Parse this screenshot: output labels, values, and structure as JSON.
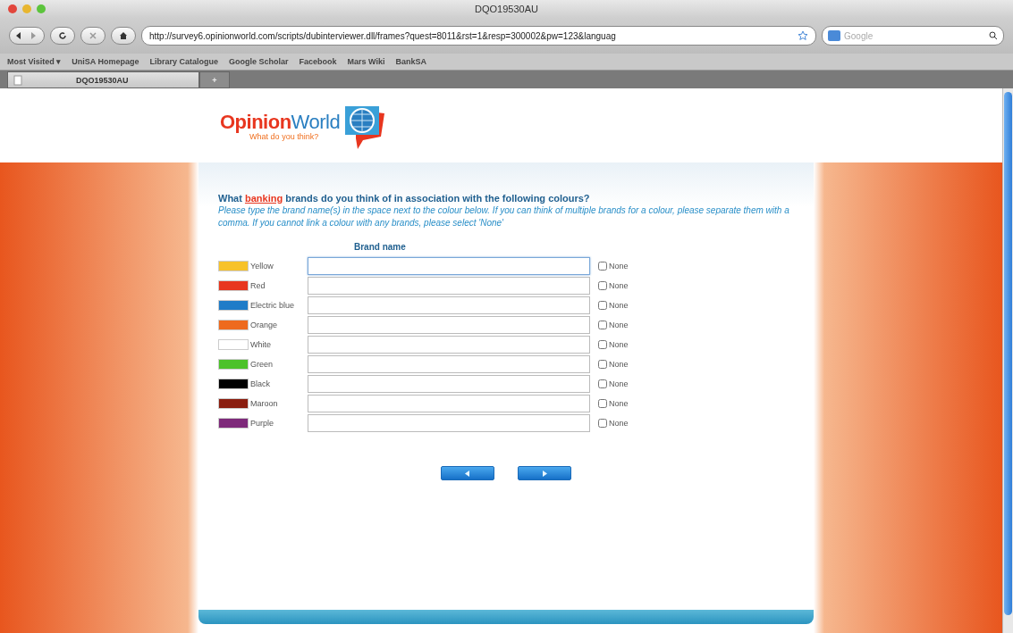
{
  "window": {
    "title": "DQO19530AU"
  },
  "toolbar": {
    "url": "http://survey6.opinionworld.com/scripts/dubinterviewer.dll/frames?quest=8011&rst=1&resp=300002&pw=123&languag",
    "search_placeholder": "Google"
  },
  "bookmarks": [
    "Most Visited ▾",
    "UniSA Homepage",
    "Library Catalogue",
    "Google Scholar",
    "Facebook",
    "Mars Wiki",
    "BankSA"
  ],
  "tabs": [
    {
      "label": "DQO19530AU",
      "selected": true
    },
    {
      "label": "+",
      "selected": false
    }
  ],
  "logo": {
    "name_part1": "Opinion",
    "name_part2": "World",
    "tagline": "What do you think?"
  },
  "question": {
    "title": "What **banking** brands do you think of in association with the following colours?",
    "instructions": "Please type the brand name(s) in the space next to the colour below. If you can think of multiple brands for a colour, please separate them with a comma. If you cannot link a colour with any brands, please select 'None'"
  },
  "column_header": "Brand name",
  "rows": [
    {
      "label": "Yellow",
      "color": "#f7c22a",
      "focused": true,
      "checked": false,
      "none_label": "None"
    },
    {
      "label": "Red",
      "color": "#e8361f",
      "focused": false,
      "checked": false,
      "none_label": "None"
    },
    {
      "label": "Electric blue",
      "color": "#1f7cc8",
      "focused": false,
      "checked": false,
      "none_label": "None"
    },
    {
      "label": "Orange",
      "color": "#ee6a1e",
      "focused": false,
      "checked": false,
      "none_label": "None"
    },
    {
      "label": "White",
      "color": "#ffffff",
      "focused": false,
      "checked": false,
      "none_label": "None"
    },
    {
      "label": "Green",
      "color": "#4cc22a",
      "focused": false,
      "checked": false,
      "none_label": "None"
    },
    {
      "label": "Black",
      "color": "#000000",
      "focused": false,
      "checked": false,
      "none_label": "None"
    },
    {
      "label": "Maroon",
      "color": "#8a1e10",
      "focused": false,
      "checked": false,
      "none_label": "None"
    },
    {
      "label": "Purple",
      "color": "#7e2a7a",
      "focused": false,
      "checked": false,
      "none_label": "None"
    }
  ],
  "nav_buttons": [
    {
      "kind": "back"
    },
    {
      "kind": "next"
    }
  ]
}
